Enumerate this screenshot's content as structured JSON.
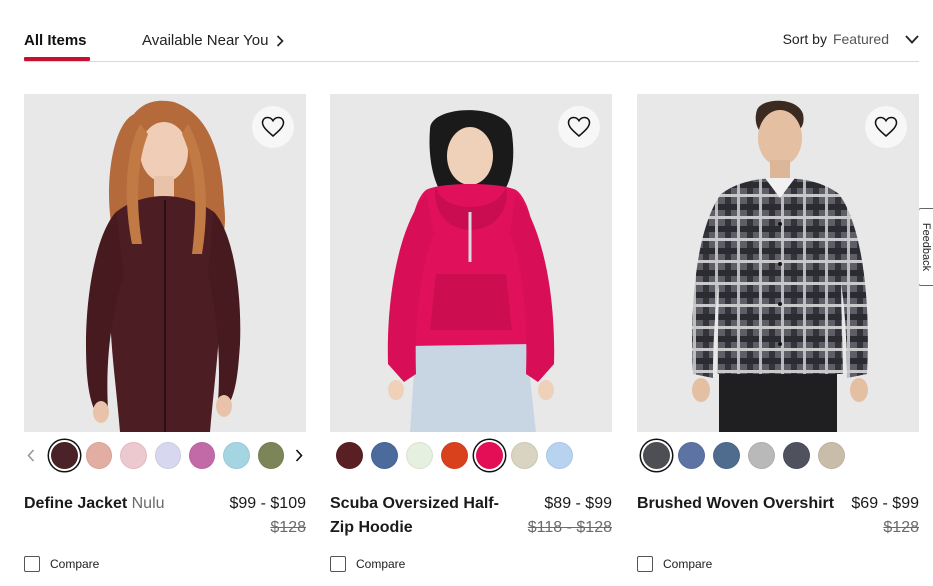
{
  "toolbar": {
    "all_items": "All Items",
    "near_you": "Available Near You",
    "sort_label": "Sort by",
    "sort_value": "Featured"
  },
  "feedback": "Feedback",
  "colors": {
    "accent": "#c8102e"
  },
  "products": [
    {
      "name": "Define Jacket",
      "sub": "Nulu",
      "price": "$99 - $109",
      "was": "$128",
      "compare": "Compare",
      "swatches": [
        "#4a2228",
        "#e2aea3",
        "#ecc9cf",
        "#d7d8ef",
        "#c26aa8",
        "#a6d5e2",
        "#7b8558"
      ]
    },
    {
      "name": "Scuba Oversized Half-",
      "name2": "Zip Hoodie",
      "price": "$89 - $99",
      "was": "$118 - $128",
      "compare": "Compare",
      "swatches": [
        "#5a1f23",
        "#4b6b9c",
        "#e6f0e0",
        "#d9411d",
        "#e40e56",
        "#d9d3c1",
        "#b7d3f0"
      ]
    },
    {
      "name": "Brushed Woven Overshirt",
      "price": "$69 - $99",
      "was": "$128",
      "compare": "Compare",
      "swatches": [
        "#4e4f55",
        "#5c73a3",
        "#4f6c8e",
        "#b9b9b9",
        "#4f525d",
        "#c9bda9"
      ]
    }
  ]
}
